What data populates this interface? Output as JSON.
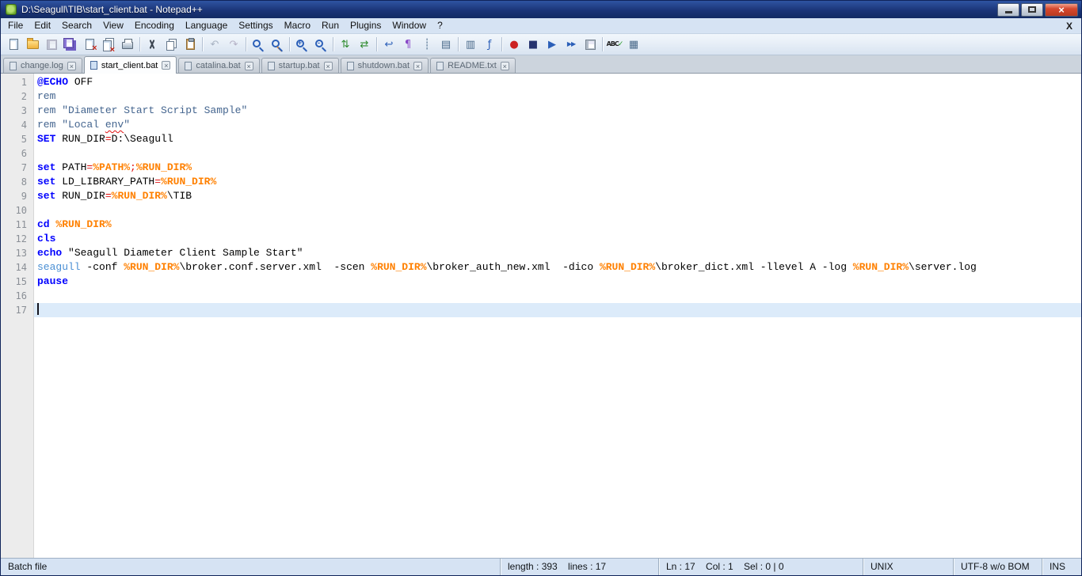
{
  "window": {
    "title": "D:\\Seagull\\TIB\\start_client.bat - Notepad++"
  },
  "menubar": {
    "items": [
      "File",
      "Edit",
      "Search",
      "View",
      "Encoding",
      "Language",
      "Settings",
      "Macro",
      "Run",
      "Plugins",
      "Window",
      "?"
    ],
    "close_label": "X"
  },
  "toolbar": {
    "groups": [
      [
        {
          "name": "new-file"
        },
        {
          "name": "open"
        },
        {
          "name": "save",
          "disabled": true
        },
        {
          "name": "save-all"
        },
        {
          "name": "close"
        },
        {
          "name": "close-all"
        },
        {
          "name": "print"
        }
      ],
      [
        {
          "name": "cut"
        },
        {
          "name": "copy"
        },
        {
          "name": "paste"
        }
      ],
      [
        {
          "name": "undo",
          "disabled": true
        },
        {
          "name": "redo",
          "disabled": true
        }
      ],
      [
        {
          "name": "find"
        },
        {
          "name": "replace"
        }
      ],
      [
        {
          "name": "zoom-in"
        },
        {
          "name": "zoom-out"
        }
      ],
      [
        {
          "name": "sync-vertical"
        },
        {
          "name": "sync-horizontal"
        }
      ],
      [
        {
          "name": "word-wrap"
        },
        {
          "name": "show-all-characters"
        },
        {
          "name": "show-indent-guide"
        },
        {
          "name": "define-language"
        }
      ],
      [
        {
          "name": "document-map"
        },
        {
          "name": "function-list"
        }
      ],
      [
        {
          "name": "macro-record"
        },
        {
          "name": "macro-stop"
        },
        {
          "name": "macro-play"
        },
        {
          "name": "macro-run-multiple"
        },
        {
          "name": "macro-save"
        }
      ],
      [
        {
          "name": "spell-check"
        },
        {
          "name": "doc-switcher"
        }
      ]
    ]
  },
  "tabs": [
    {
      "label": "change.log",
      "active": false
    },
    {
      "label": "start_client.bat",
      "active": true
    },
    {
      "label": "catalina.bat",
      "active": false
    },
    {
      "label": "startup.bat",
      "active": false
    },
    {
      "label": "shutdown.bat",
      "active": false
    },
    {
      "label": "README.txt",
      "active": false
    }
  ],
  "editor": {
    "caret_line": 17,
    "lines": [
      {
        "num": 1,
        "tokens": [
          {
            "t": "@ECHO",
            "c": "kw"
          },
          {
            "t": " OFF",
            "c": "pl"
          }
        ]
      },
      {
        "num": 2,
        "tokens": [
          {
            "t": "rem",
            "c": "cm"
          }
        ]
      },
      {
        "num": 3,
        "tokens": [
          {
            "t": "rem \"Diameter Start Script Sample\"",
            "c": "cm"
          }
        ]
      },
      {
        "num": 4,
        "tokens": [
          {
            "t": "rem \"Local ",
            "c": "cm"
          },
          {
            "t": "env",
            "c": "cm sq"
          },
          {
            "t": "\"",
            "c": "cm"
          }
        ]
      },
      {
        "num": 5,
        "tokens": [
          {
            "t": "SET",
            "c": "kw"
          },
          {
            "t": " RUN_DIR",
            "c": "pl"
          },
          {
            "t": "=",
            "c": "op"
          },
          {
            "t": "D:\\Seagull",
            "c": "pl"
          }
        ]
      },
      {
        "num": 6,
        "tokens": []
      },
      {
        "num": 7,
        "tokens": [
          {
            "t": "set",
            "c": "kw"
          },
          {
            "t": " PATH",
            "c": "pl"
          },
          {
            "t": "=",
            "c": "op"
          },
          {
            "t": "%PATH%",
            "c": "var"
          },
          {
            "t": ";",
            "c": "op"
          },
          {
            "t": "%RUN_DIR%",
            "c": "var"
          }
        ]
      },
      {
        "num": 8,
        "tokens": [
          {
            "t": "set",
            "c": "kw"
          },
          {
            "t": " LD_LIBRARY_PATH",
            "c": "pl"
          },
          {
            "t": "=",
            "c": "op"
          },
          {
            "t": "%RUN_DIR%",
            "c": "var"
          }
        ]
      },
      {
        "num": 9,
        "tokens": [
          {
            "t": "set",
            "c": "kw"
          },
          {
            "t": " RUN_DIR",
            "c": "pl"
          },
          {
            "t": "=",
            "c": "op"
          },
          {
            "t": "%RUN_DIR%",
            "c": "var"
          },
          {
            "t": "\\TIB",
            "c": "pl"
          }
        ]
      },
      {
        "num": 10,
        "tokens": []
      },
      {
        "num": 11,
        "tokens": [
          {
            "t": "cd",
            "c": "kw"
          },
          {
            "t": " ",
            "c": "pl"
          },
          {
            "t": "%RUN_DIR%",
            "c": "var"
          }
        ]
      },
      {
        "num": 12,
        "tokens": [
          {
            "t": "cls",
            "c": "kw"
          }
        ]
      },
      {
        "num": 13,
        "tokens": [
          {
            "t": "echo",
            "c": "kw"
          },
          {
            "t": " \"Seagull Diameter Client Sample Start\"",
            "c": "pl"
          }
        ]
      },
      {
        "num": 14,
        "tokens": [
          {
            "t": "seagull",
            "c": "cmd"
          },
          {
            "t": " -conf ",
            "c": "pl"
          },
          {
            "t": "%RUN_DIR%",
            "c": "var"
          },
          {
            "t": "\\broker.conf.server.xml  -scen ",
            "c": "pl"
          },
          {
            "t": "%RUN_DIR%",
            "c": "var"
          },
          {
            "t": "\\broker_auth_new.xml  -dico ",
            "c": "pl"
          },
          {
            "t": "%RUN_DIR%",
            "c": "var"
          },
          {
            "t": "\\broker_dict.xml -llevel A -log ",
            "c": "pl"
          },
          {
            "t": "%RUN_DIR%",
            "c": "var"
          },
          {
            "t": "\\server.log",
            "c": "pl"
          }
        ]
      },
      {
        "num": 15,
        "tokens": [
          {
            "t": "pause",
            "c": "kw"
          }
        ]
      },
      {
        "num": 16,
        "tokens": []
      },
      {
        "num": 17,
        "tokens": []
      }
    ]
  },
  "statusbar": {
    "doc_type": "Batch file",
    "length_lines": "length : 393    lines : 17",
    "position": "Ln : 17    Col : 1    Sel : 0 | 0",
    "eol": "UNIX",
    "encoding": "UTF-8 w/o BOM",
    "mode": "INS"
  },
  "colors": {
    "keyword": "#0000ff",
    "comment": "#44658f",
    "variable": "#ff8000",
    "operator": "#e01010",
    "command": "#4a8fd4",
    "current_line": "#dcebfa"
  }
}
